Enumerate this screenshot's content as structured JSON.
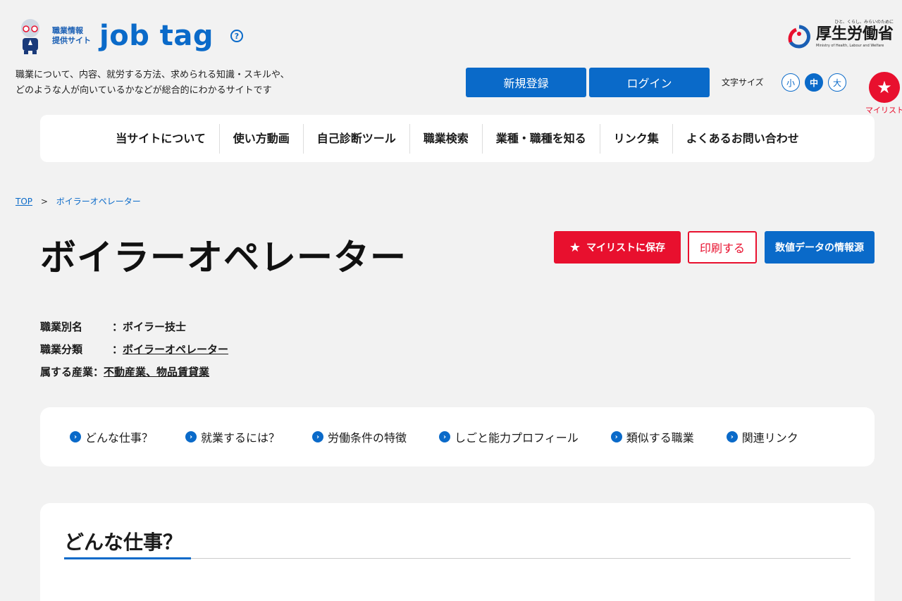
{
  "header": {
    "logo_small_line1": "職業情報",
    "logo_small_line2": "提供サイト",
    "logo_text": "job tag",
    "help_icon": "question-circle-icon",
    "tagline_line1": "職業について、内容、就労する方法、求められる知識・スキルや、",
    "tagline_line2": "どのような人が向いているかなどが総合的にわかるサイトです",
    "register_label": "新規登録",
    "login_label": "ログイン",
    "font_size_label": "文字サイズ",
    "font_size_small": "小",
    "font_size_mid": "中",
    "font_size_large": "大",
    "mylist_label": "マイリスト",
    "ministry_tagline": "ひと、くらし、みらいのために",
    "ministry_name": "厚生労働省",
    "ministry_en": "Ministry of Health, Labour and Welfare"
  },
  "nav": {
    "items": [
      "当サイトについて",
      "使い方動画",
      "自己診断ツール",
      "職業検索",
      "業種・職種を知る",
      "リンク集",
      "よくあるお問い合わせ"
    ]
  },
  "breadcrumb": {
    "top": "TOP",
    "separator": ">",
    "current": "ボイラーオペレーター"
  },
  "page": {
    "title": "ボイラーオペレーター",
    "save_label": "マイリストに保存",
    "print_label": "印刷する",
    "data_source_label": "数値データの情報源"
  },
  "meta": {
    "alias_key": "職業別名",
    "alias_value": "：ボイラー技士",
    "category_key": "職業分類",
    "category_colon": "：",
    "category_value": "ボイラーオペレーター",
    "industry_key": "属する産業",
    "industry_colon": "：",
    "industry_value": "不動産業、物品賃貸業"
  },
  "anchors": [
    "どんな仕事？",
    "就業するには？",
    "労働条件の特徴",
    "しごと能力プロフィール",
    "類似する職業",
    "関連リンク"
  ],
  "section": {
    "title": "どんな仕事？"
  },
  "colors": {
    "primary": "#0a6ac9",
    "accent_red": "#e8102e",
    "background": "#f2f2f2"
  }
}
